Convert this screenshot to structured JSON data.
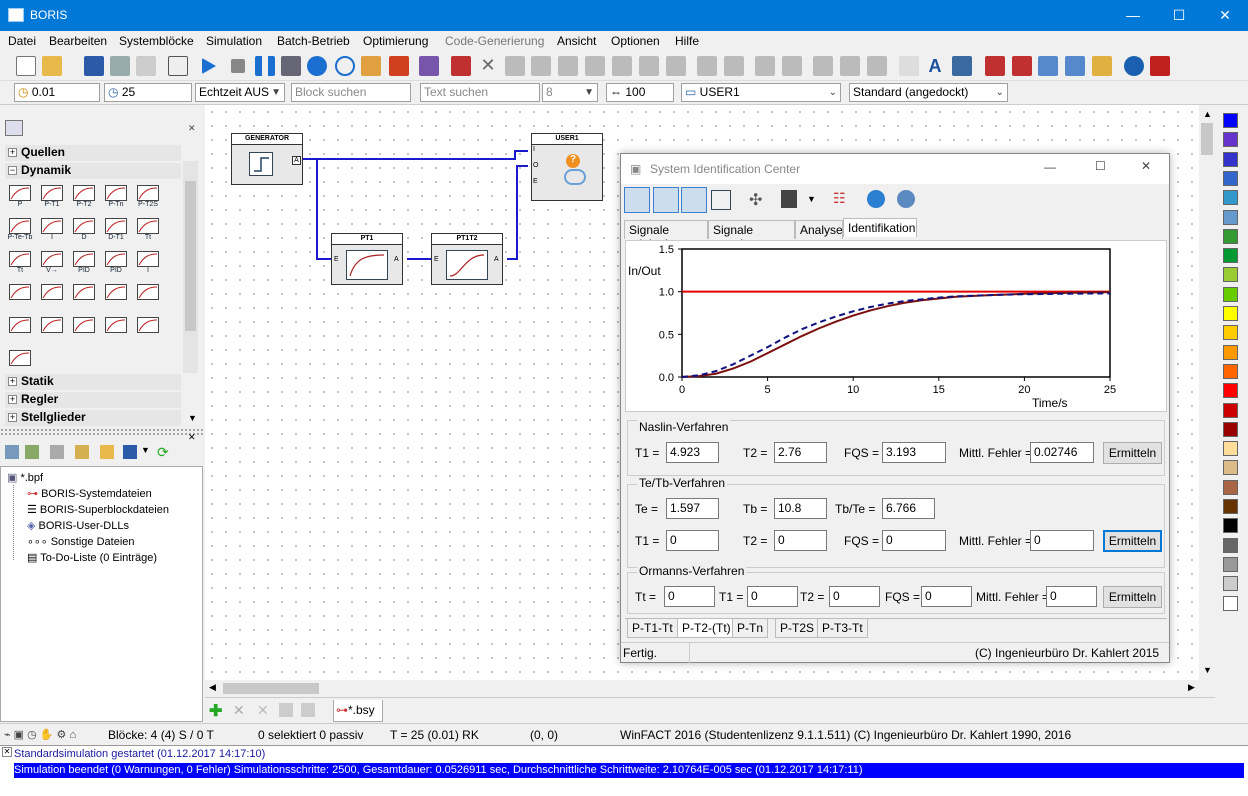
{
  "window": {
    "title": "BORIS",
    "min": "—",
    "max": "☐",
    "close": "✕"
  },
  "menu": [
    "Datei",
    "Bearbeiten",
    "Systemblöcke",
    "Simulation",
    "Batch-Betrieb",
    "Optimierung",
    "Code-Generierung",
    "Ansicht",
    "Optionen",
    "Hilfe"
  ],
  "toolbar2": {
    "step": "0.01",
    "end": "25",
    "realtime": "Echtzeit AUS",
    "block_search": "Block suchen",
    "text_search": "Text suchen",
    "font_size": "8",
    "zoom": "100",
    "user": "USER1",
    "dock": "Standard (angedockt)"
  },
  "library": {
    "groups": {
      "quellen": "Quellen",
      "dynamik": "Dynamik",
      "statik": "Statik",
      "regler": "Regler",
      "stellglieder": "Stellglieder"
    },
    "blocks_row1": [
      "P",
      "P-T1",
      "P-T2",
      "P-Tn",
      "P-T2S"
    ],
    "blocks_row2": [
      "P-Te-Tb",
      "I",
      "D",
      "D-T1",
      "Tt"
    ],
    "blocks_row3": [
      "Tt",
      "V→",
      "PID",
      "PID",
      "I"
    ]
  },
  "tree": {
    "root": "*.bpf",
    "items": [
      "BORIS-Systemdateien",
      "BORIS-Superblockdateien",
      "BORIS-User-DLLs",
      "Sonstige Dateien",
      "To-Do-Liste (0 Einträge)"
    ]
  },
  "diagram": {
    "generator": "GENERATOR",
    "user": "USER1",
    "pt1": "PT1",
    "pt1t2": "PT1T2",
    "port_a": "A",
    "port_e": "E",
    "port_i": "I",
    "port_o": "O"
  },
  "file_tab": "*.bsy",
  "status": {
    "blocks": "Blöcke: 4 (4) S / 0 T",
    "selected": "0 selektiert  0 passiv",
    "time": "T = 25  (0.01)  RK",
    "coords": "(0, 0)",
    "license": "WinFACT 2016 (Studentenlizenz 9.1.1.511)  (C) Ingenieurbüro Dr. Kahlert 1990, 2016"
  },
  "log": [
    {
      "text": "Standardsimulation gestartet     (01.12.2017 14:17:10)"
    },
    {
      "text": "Simulation beendet (0 Warnungen, 0 Fehler)    Simulationsschritte: 2500, Gesamtdauer:  0.0526911 sec, Durchschnittliche Schrittweite: 2.10764E-005 sec    (01.12.2017 14:17:11)"
    }
  ],
  "dialog": {
    "title": "System Identification Center",
    "tabs": [
      "Signale original",
      "Signale normiert",
      "Analyse",
      "Identifikation"
    ],
    "naslin": {
      "title": "Naslin-Verfahren",
      "t1_label": "T1  =",
      "t1": "4.923",
      "t2_label": "T2  =",
      "t2": "2.76",
      "fqs_label": "FQS  =",
      "fqs": "3.193",
      "err_label": "Mittl. Fehler  =",
      "err": "0.02746",
      "btn": "Ermitteln"
    },
    "tetb": {
      "title": "Te/Tb-Verfahren",
      "te_label": "Te  =",
      "te": "1.597",
      "tb_label": "Tb  =",
      "tb": "10.8",
      "ratio_label": "Tb/Te  =",
      "ratio": "6.766",
      "t1_label": "T1  =",
      "t1": "0",
      "t2_label": "T2  =",
      "t2": "0",
      "fqs_label": "FQS  =",
      "fqs": "0",
      "err_label": "Mittl. Fehler  =",
      "err": "0",
      "btn": "Ermitteln"
    },
    "ormanns": {
      "title": "Ormanns-Verfahren",
      "tt_label": "Tt  =",
      "tt": "0",
      "t1_label": "T1  =",
      "t1": "0",
      "t2_label": "T2  =",
      "t2": "0",
      "fqs_label": "FQS  =",
      "fqs": "0",
      "err_label": "Mittl. Fehler  =",
      "err": "0",
      "btn": "Ermitteln"
    },
    "bottom_tabs": [
      "P-T1-Tt",
      "P-T2-(Tt)",
      "P-Tn",
      "P-T2S",
      "P-T3-Tt"
    ],
    "status_left": "Fertig.",
    "status_right": "(C) Ingenieurbüro Dr. Kahlert 2015"
  },
  "chart_data": {
    "type": "line",
    "ylabel": "In/Out",
    "xlabel": "Time/s",
    "xlim": [
      0,
      25
    ],
    "ylim": [
      0,
      1.5
    ],
    "xticks": [
      "0",
      "5",
      "10",
      "15",
      "20",
      "25"
    ],
    "yticks": [
      "0.0",
      "0.5",
      "1.0",
      "1.5"
    ],
    "series": [
      {
        "color": "#e00000",
        "style": "solid",
        "x": [
          0,
          25
        ],
        "y": [
          1,
          1
        ]
      },
      {
        "color": "#7a1010",
        "style": "solid",
        "x": [
          0,
          1,
          2,
          3,
          4,
          5,
          6,
          7,
          8,
          9,
          10,
          11,
          12,
          13,
          14,
          15,
          16,
          18,
          20,
          22,
          25
        ],
        "y": [
          0,
          0.01,
          0.04,
          0.1,
          0.18,
          0.28,
          0.38,
          0.48,
          0.57,
          0.65,
          0.72,
          0.78,
          0.83,
          0.87,
          0.9,
          0.92,
          0.94,
          0.96,
          0.975,
          0.985,
          0.995
        ]
      },
      {
        "color": "#101080",
        "style": "dashed",
        "x": [
          0,
          1,
          2,
          3,
          4,
          5,
          6,
          7,
          8,
          9,
          10,
          11,
          12,
          13,
          14,
          15,
          16,
          18,
          20,
          22,
          25
        ],
        "y": [
          0,
          0.02,
          0.07,
          0.15,
          0.25,
          0.35,
          0.46,
          0.56,
          0.64,
          0.71,
          0.77,
          0.82,
          0.86,
          0.89,
          0.91,
          0.93,
          0.945,
          0.96,
          0.97,
          0.975,
          0.98
        ]
      }
    ]
  },
  "palette_colors": [
    "#0000ff",
    "#6633cc",
    "#3333cc",
    "#3366cc",
    "#3399cc",
    "#6699cc",
    "#339933",
    "#009933",
    "#99cc33",
    "#66cc00",
    "#ffff00",
    "#ffcc00",
    "#ff9900",
    "#ff6600",
    "#ff0000",
    "#cc0000",
    "#990000",
    "#ffdd99",
    "#ddbb88",
    "#aa6644",
    "#663300",
    "#000000",
    "#666666",
    "#999999",
    "#cccccc",
    "#ffffff"
  ]
}
